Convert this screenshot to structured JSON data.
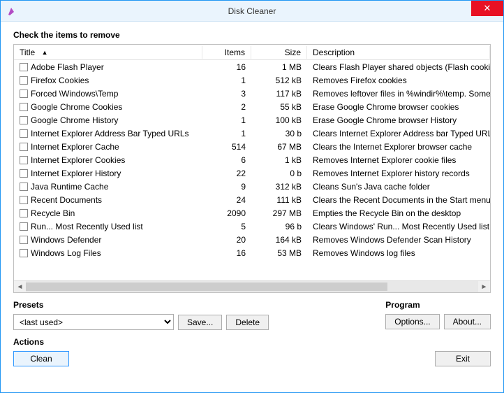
{
  "window": {
    "title": "Disk Cleaner"
  },
  "heading": "Check the items to remove",
  "columns": {
    "title": "Title",
    "items": "Items",
    "size": "Size",
    "description": "Description"
  },
  "rows": [
    {
      "title": "Adobe Flash Player",
      "items": "16",
      "size": "1 MB",
      "desc": "Clears Flash Player shared objects (Flash cookies)"
    },
    {
      "title": "Firefox Cookies",
      "items": "1",
      "size": "512 kB",
      "desc": "Removes Firefox cookies"
    },
    {
      "title": "Forced \\Windows\\Temp",
      "items": "3",
      "size": "117 kB",
      "desc": "Removes leftover files in %windir%\\temp. Some appli"
    },
    {
      "title": "Google Chrome Cookies",
      "items": "2",
      "size": "55 kB",
      "desc": "Erase Google Chrome browser cookies"
    },
    {
      "title": "Google Chrome History",
      "items": "1",
      "size": "100 kB",
      "desc": "Erase Google Chrome browser History"
    },
    {
      "title": "Internet Explorer Address Bar Typed URLs",
      "items": "1",
      "size": "30 b",
      "desc": "Clears Internet Explorer Address bar Typed URLs"
    },
    {
      "title": "Internet Explorer Cache",
      "items": "514",
      "size": "67 MB",
      "desc": "Clears the Internet Explorer browser cache"
    },
    {
      "title": "Internet Explorer Cookies",
      "items": "6",
      "size": "1 kB",
      "desc": "Removes Internet Explorer cookie files"
    },
    {
      "title": "Internet Explorer History",
      "items": "22",
      "size": "0 b",
      "desc": "Removes Internet Explorer history records"
    },
    {
      "title": "Java Runtime Cache",
      "items": "9",
      "size": "312 kB",
      "desc": "Cleans Sun's Java cache folder"
    },
    {
      "title": "Recent Documents",
      "items": "24",
      "size": "111 kB",
      "desc": "Clears the Recent Documents in the Start menu"
    },
    {
      "title": "Recycle Bin",
      "items": "2090",
      "size": "297 MB",
      "desc": "Empties the Recycle Bin on the desktop"
    },
    {
      "title": "Run... Most Recently Used list",
      "items": "5",
      "size": "96 b",
      "desc": "Clears Windows' Run... Most Recently Used list"
    },
    {
      "title": "Windows Defender",
      "items": "20",
      "size": "164 kB",
      "desc": "Removes Windows Defender Scan History"
    },
    {
      "title": "Windows Log Files",
      "items": "16",
      "size": "53 MB",
      "desc": "Removes Windows log files"
    }
  ],
  "presets": {
    "label": "Presets",
    "selected": "<last used>",
    "save": "Save...",
    "delete": "Delete"
  },
  "program": {
    "label": "Program",
    "options": "Options...",
    "about": "About..."
  },
  "actions": {
    "label": "Actions",
    "clean": "Clean",
    "exit": "Exit"
  }
}
